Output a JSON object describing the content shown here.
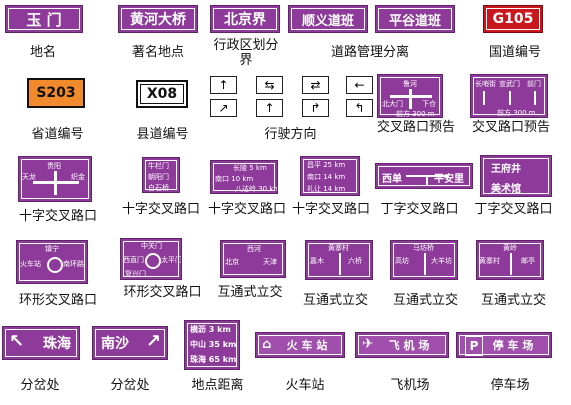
{
  "row1": {
    "s1": "玉 门",
    "s2": "黄河大桥",
    "s3": "北京界",
    "s4": "顺义道班",
    "s5": "平谷道班",
    "s6": "G105",
    "c1": "地名",
    "c2": "著名地点",
    "c3": "行政区划分界",
    "c4": "道路管理分离",
    "c5": "国道编号"
  },
  "row2": {
    "s1": "S203",
    "s2": "X08",
    "c1": "省道编号",
    "c2": "县道编号",
    "c3": "行驶方向",
    "c4": "交叉路口预告",
    "c5": "交叉路口预告",
    "sign4": {
      "top": "鲁河",
      "left": "北大门",
      "right": "下仓",
      "dist": "前方 300 m"
    },
    "sign5": {
      "left": "长哨街",
      "mid": "宣武门",
      "right": "前门",
      "dist": "前方 300 m"
    }
  },
  "row3": {
    "c1": "十字交叉路口",
    "c2": "十字交叉路口",
    "c3": "十字交叉路口",
    "c4": "十字交叉路口",
    "c5": "丁字交叉路口",
    "c6": "丁字交叉路口",
    "sign1": {
      "top": "贵阳",
      "left": "天龙",
      "right": "织金"
    },
    "sign2": {
      "l1": "牛栏门",
      "l2": "朝阳门",
      "l3": "白石桥"
    },
    "sign3": {
      "l1": "长陵 5 km",
      "l2": "南口 10 km",
      "l3": "八达岭 30 km"
    },
    "sign4": {
      "l1": "昌平 25 km",
      "l2": "南口 14 km",
      "l3": "礼让 14 km"
    },
    "sign5": {
      "left": "西单",
      "right": "平安里"
    },
    "sign6": {
      "t1": "王府井",
      "t2": "美术馆"
    }
  },
  "row4": {
    "c1": "环形交叉路口",
    "c2": "环形交叉路口",
    "c3": "互通式立交",
    "c4": "互通式立交",
    "c5": "互通式立交",
    "c6": "互通式立交",
    "sign1": {
      "top": "镇宁",
      "left": "火车站",
      "right": "南环路"
    },
    "sign2": {
      "top": "中关门",
      "left": "西直门",
      "right": "太平门",
      "bottom": "复兴门"
    },
    "sign3": {
      "top": "西河",
      "left": "北京",
      "right": "天津"
    },
    "sign4": {
      "top": "黄寨村",
      "left": "嘉木",
      "right": "六桥"
    },
    "sign5": {
      "top": "马坊桥",
      "left": "高坊",
      "right": "大羊坊"
    },
    "sign6": {
      "top": "黄岭",
      "left": "黄寨村",
      "right": "邮亭"
    }
  },
  "row5": {
    "s1": "珠海",
    "s2": "南沙",
    "dist": [
      "横沥 3 km",
      "中山 35 km",
      "珠海 65 km"
    ],
    "s4": "火 车 站",
    "s5": "飞 机 场",
    "s6": "停 车 场",
    "s6_letter": "P",
    "c1": "分岔处",
    "c2": "分岔处",
    "c3": "地点距离",
    "c4": "火车站",
    "c5": "飞机场",
    "c6": "停车场"
  },
  "arrows": [
    "↑",
    "⇆",
    "⇄",
    "←",
    "↗",
    "↑",
    "↱",
    "↰"
  ]
}
